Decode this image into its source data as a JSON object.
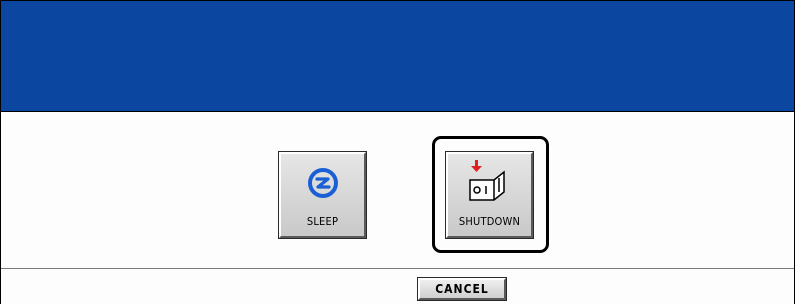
{
  "dialog": {
    "sleep_label": "SLEEP",
    "shutdown_label": "SHUTDOWN",
    "cancel_label": "CANCEL"
  },
  "icons": {
    "sleep": "sleep-icon",
    "shutdown": "power-switch-icon"
  },
  "colors": {
    "banner": "#0b46a0",
    "sleep_icon": "#1a5fd6",
    "shutdown_arrow": "#e02020"
  }
}
